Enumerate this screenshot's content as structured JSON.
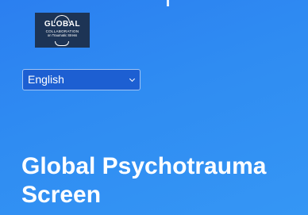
{
  "logo": {
    "line1": "GLOBAL",
    "line2": "COLLABORATION",
    "line3": "on Traumatic Stress"
  },
  "language_select": {
    "value": "English"
  },
  "page": {
    "title_line1": "Global Psychotrauma",
    "title_line2": "Screen"
  },
  "colors": {
    "background": "#2f8cf2",
    "select_bg": "#1d5fd2",
    "logo_bg": "#1d3455",
    "text": "#ffffff"
  }
}
